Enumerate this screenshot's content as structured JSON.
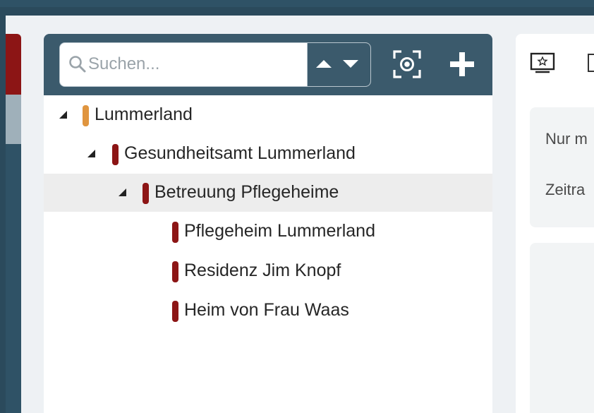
{
  "colors": {
    "background": "#2b4a5c",
    "toolbar": "#3b5a6c",
    "marker_orange": "#e0953f",
    "marker_red": "#8c1515",
    "selected_row": "#ededed"
  },
  "search": {
    "placeholder": "Suchen...",
    "value": ""
  },
  "toolbar": {
    "icons": [
      "search-icon",
      "arrow-up-icon",
      "arrow-down-icon",
      "focus-icon",
      "plus-icon"
    ]
  },
  "tree": {
    "items": [
      {
        "label": "Lummerland",
        "expanded": true,
        "marker": "orange"
      },
      {
        "label": "Gesundheitsamt Lummerland",
        "expanded": true,
        "marker": "red"
      },
      {
        "label": "Betreuung Pflegeheime",
        "expanded": true,
        "marker": "red",
        "selected": true
      },
      {
        "label": "Pflegeheim Lummerland",
        "marker": "red"
      },
      {
        "label": "Residenz Jim Knopf",
        "marker": "red"
      },
      {
        "label": "Heim von Frau Waas",
        "marker": "red"
      }
    ]
  },
  "right_panel": {
    "filter_label_1": "Nur m",
    "filter_label_2": "Zeitra"
  }
}
